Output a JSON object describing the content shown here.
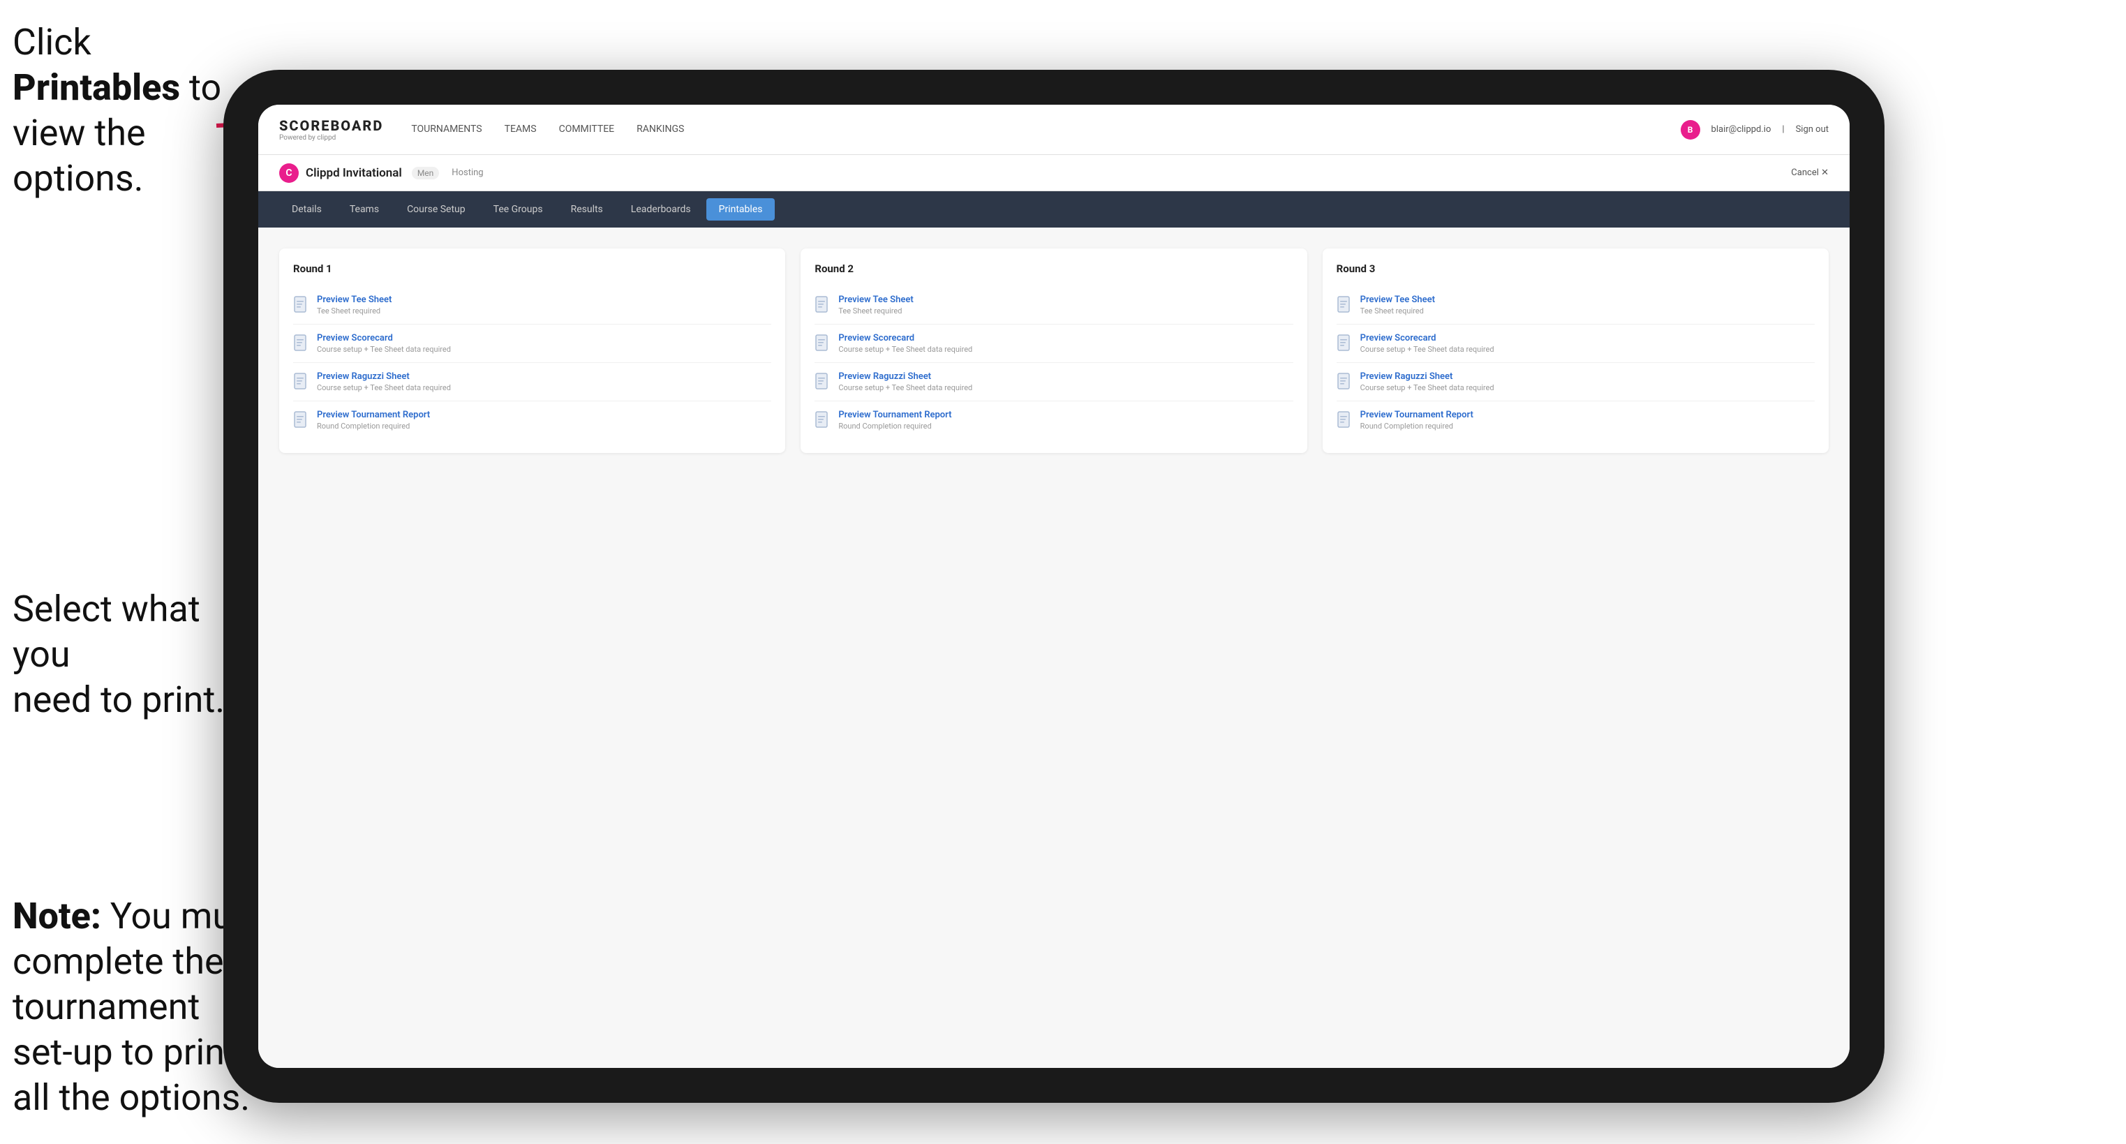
{
  "instructions": {
    "top_line1": "Click ",
    "top_bold": "Printables",
    "top_line2": " to",
    "top_line3": "view the options.",
    "middle_line1": "Select what you",
    "middle_line2": "need to print.",
    "bottom_bold": "Note:",
    "bottom_rest": " You must complete the tournament set-up to print all the options."
  },
  "nav": {
    "logo_title": "SCOREBOARD",
    "logo_sub": "Powered by clippd",
    "links": [
      "TOURNAMENTS",
      "TEAMS",
      "COMMITTEE",
      "RANKINGS"
    ],
    "user_email": "blair@clippd.io",
    "sign_in_label": "Sign out"
  },
  "tournament": {
    "name": "Clippd Invitational",
    "gender_badge": "Men",
    "status": "Hosting",
    "cancel_label": "Cancel ✕"
  },
  "sub_nav": {
    "tabs": [
      "Details",
      "Teams",
      "Course Setup",
      "Tee Groups",
      "Results",
      "Leaderboards",
      "Printables"
    ],
    "active_tab": "Printables"
  },
  "rounds": [
    {
      "title": "Round 1",
      "items": [
        {
          "title": "Preview Tee Sheet",
          "sub": "Tee Sheet required"
        },
        {
          "title": "Preview Scorecard",
          "sub": "Course setup + Tee Sheet data required"
        },
        {
          "title": "Preview Raguzzi Sheet",
          "sub": "Course setup + Tee Sheet data required"
        },
        {
          "title": "Preview Tournament Report",
          "sub": "Round Completion required"
        }
      ]
    },
    {
      "title": "Round 2",
      "items": [
        {
          "title": "Preview Tee Sheet",
          "sub": "Tee Sheet required"
        },
        {
          "title": "Preview Scorecard",
          "sub": "Course setup + Tee Sheet data required"
        },
        {
          "title": "Preview Raguzzi Sheet",
          "sub": "Course setup + Tee Sheet data required"
        },
        {
          "title": "Preview Tournament Report",
          "sub": "Round Completion required"
        }
      ]
    },
    {
      "title": "Round 3",
      "items": [
        {
          "title": "Preview Tee Sheet",
          "sub": "Tee Sheet required"
        },
        {
          "title": "Preview Scorecard",
          "sub": "Course setup + Tee Sheet data required"
        },
        {
          "title": "Preview Raguzzi Sheet",
          "sub": "Course setup + Tee Sheet data required"
        },
        {
          "title": "Preview Tournament Report",
          "sub": "Round Completion required"
        }
      ]
    }
  ],
  "icons": {
    "doc": "📄",
    "chevron": "›"
  }
}
